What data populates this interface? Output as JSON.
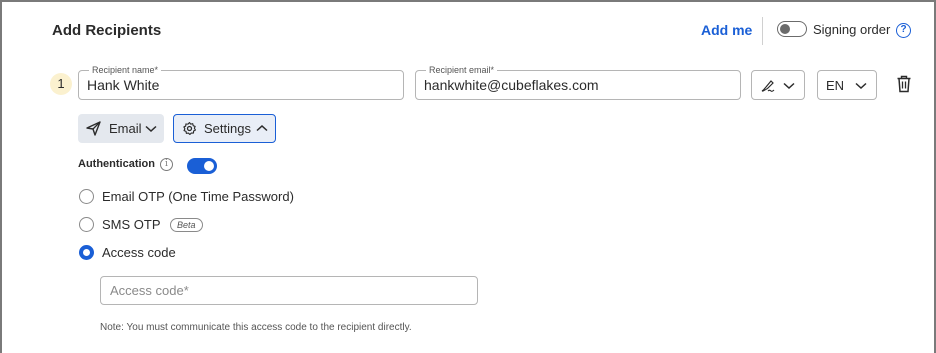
{
  "header": {
    "title": "Add Recipients",
    "add_me_label": "Add me",
    "signing_order_label": "Signing order",
    "signing_order_enabled": false,
    "help_icon_text": "?"
  },
  "recipient": {
    "index": "1",
    "name_label": "Recipient name*",
    "name_value": "Hank White",
    "email_label": "Recipient email*",
    "email_value": "hankwhite@cubeflakes.com",
    "sign_role_icon": "signature-pen-icon",
    "language_value": "EN",
    "delete_icon": "trash-icon"
  },
  "actions": {
    "email_label": "Email",
    "settings_label": "Settings"
  },
  "authentication": {
    "label": "Authentication",
    "info_icon_text": "i",
    "enabled": true,
    "options": [
      {
        "label": "Email OTP (One Time Password)",
        "selected": false
      },
      {
        "label": "SMS OTP",
        "badge": "Beta",
        "selected": false
      },
      {
        "label": "Access code",
        "selected": true
      }
    ],
    "access_code_placeholder": "Access code*",
    "access_code_value": "",
    "note": "Note: You must communicate this access code to the recipient directly."
  },
  "colors": {
    "accent": "#1a5fd6",
    "index_badge_bg": "#fbf1cf",
    "email_button_bg": "#e4e8ee"
  }
}
